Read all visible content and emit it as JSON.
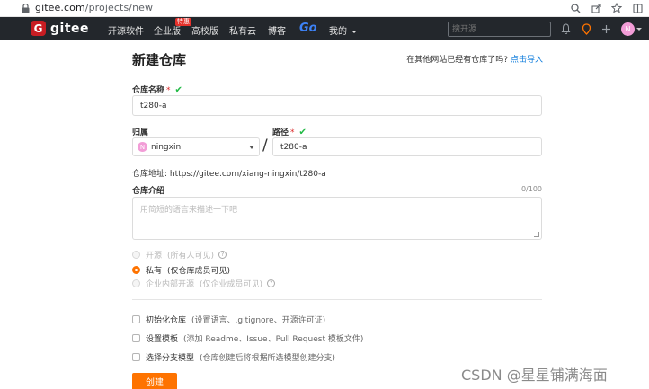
{
  "browser": {
    "url_host": "gitee.com",
    "url_path": "/projects/new"
  },
  "navbar": {
    "logo_text": "gitee",
    "logo_badge": "G",
    "items": [
      "开源软件",
      "企业版",
      "高校版",
      "私有云",
      "博客"
    ],
    "enterprise_badge": "特惠",
    "go_label": "Go",
    "mine_label": "我的",
    "search_placeholder": "搜开源",
    "avatar_letter": "N"
  },
  "page": {
    "title": "新建仓库",
    "import_hint": "在其他网站已经有仓库了吗?",
    "import_link": "点击导入"
  },
  "form": {
    "repo_name_label": "仓库名称",
    "repo_name_value": "t280-a",
    "owner_label": "归属",
    "owner_value": "ningxin",
    "owner_avatar_letter": "N",
    "path_label": "路径",
    "path_value": "t280-a",
    "separator": "/",
    "required_mark": "*",
    "valid_mark": "✔",
    "address_label": "仓库地址:",
    "address_value": "https://gitee.com/xiang-ningxin/t280-a",
    "desc_label": "仓库介绍",
    "desc_counter": "0/100",
    "desc_placeholder": "用简短的语言来描述一下吧",
    "visibility": [
      {
        "label": "开源",
        "hint": "(所有人可见)",
        "selected": false,
        "disabled": true
      },
      {
        "label": "私有",
        "hint": "(仅仓库成员可见)",
        "selected": true,
        "disabled": false
      },
      {
        "label": "企业内部开源",
        "hint": "(仅企业成员可见)",
        "selected": false,
        "disabled": true
      }
    ],
    "options": [
      {
        "label": "初始化仓库",
        "hint": "(设置语言、.gitignore、开源许可证)"
      },
      {
        "label": "设置模板",
        "hint": "(添加 Readme、Issue、Pull Request 模板文件)"
      },
      {
        "label": "选择分支模型",
        "hint": "(仓库创建后将根据所选模型创建分支)"
      }
    ],
    "submit_label": "创建",
    "help_mark": "?"
  },
  "watermark": "CSDN @星星铺满海面"
}
